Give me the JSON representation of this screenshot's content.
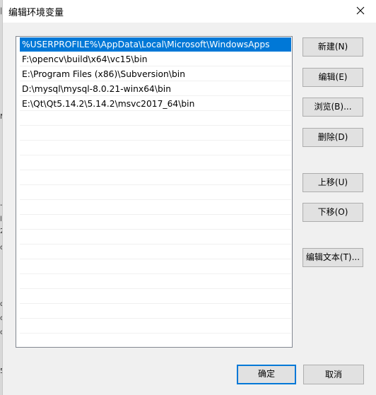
{
  "background_window": {
    "glyphs": [
      "|",
      "N",
      "-",
      "l",
      "2",
      "c",
      "d",
      "c",
      "c",
      "5"
    ]
  },
  "dialog": {
    "title": "编辑环境变量",
    "close_glyph": "✕"
  },
  "path_list": {
    "items": [
      "%USERPROFILE%\\AppData\\Local\\Microsoft\\WindowsApps",
      "F:\\opencv\\build\\x64\\vc15\\bin",
      "E:\\Program Files (x86)\\Subversion\\bin",
      "D:\\mysql\\mysql-8.0.21-winx64\\bin",
      "E:\\Qt\\Qt5.14.2\\5.14.2\\msvc2017_64\\bin"
    ],
    "selected_index": 0,
    "empty_rows": 16
  },
  "buttons": {
    "new": "新建(N)",
    "edit": "编辑(E)",
    "browse": "浏览(B)...",
    "delete": "删除(D)",
    "move_up": "上移(U)",
    "move_down": "下移(O)",
    "edit_text": "编辑文本(T)...",
    "ok": "确定",
    "cancel": "取消"
  },
  "colors": {
    "selection": "#0078d7",
    "dialog_bg": "#f0f0f0",
    "button_face": "#e1e1e1",
    "button_border": "#adadad",
    "default_button_border": "#0078d7"
  }
}
